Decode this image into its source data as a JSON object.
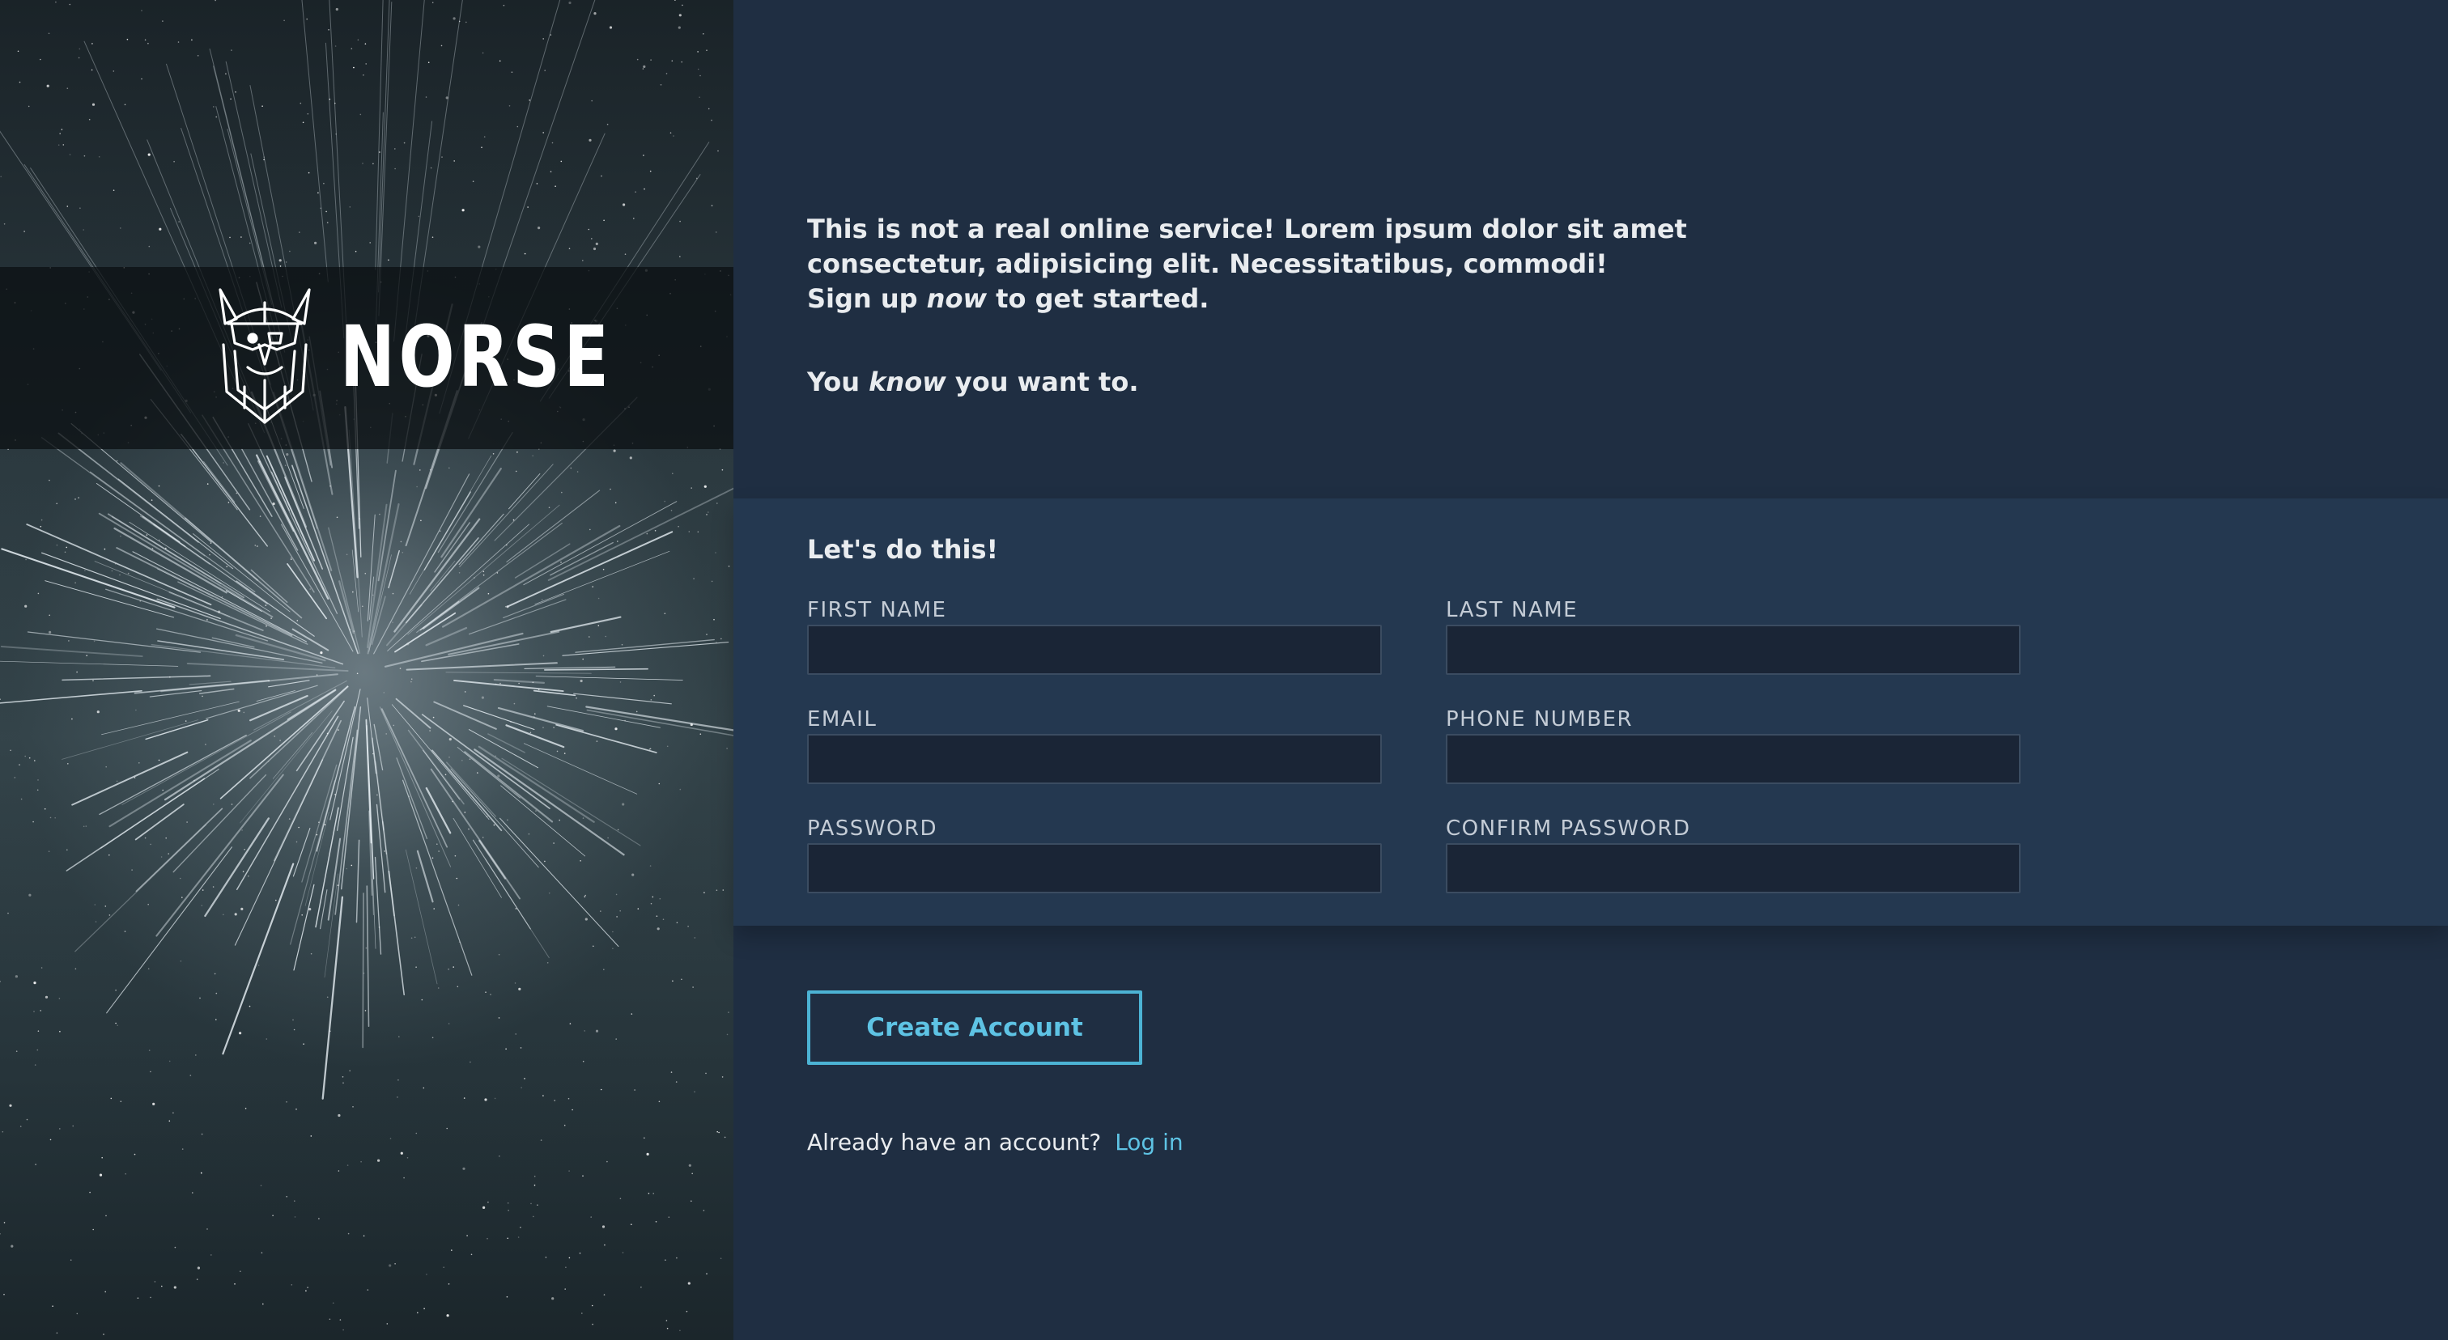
{
  "brand": {
    "name": "NORSE",
    "logo_icon": "viking-helmet-icon"
  },
  "intro": {
    "line1_part1": "This is not a real online service! Lorem ipsum dolor sit amet consectetur, adipisicing elit. Necessitatibus, commodi!",
    "line1_part2_before": "Sign up",
    "line1_part2_em": "now",
    "line1_part2_after": "to get started.",
    "line2_before": "You",
    "line2_em": "know",
    "line2_after": "you want to."
  },
  "form": {
    "heading": "Let's do this!",
    "fields": {
      "first_name": {
        "label": "FIRST NAME",
        "value": ""
      },
      "last_name": {
        "label": "LAST NAME",
        "value": ""
      },
      "email": {
        "label": "EMAIL",
        "value": ""
      },
      "phone": {
        "label": "PHONE NUMBER",
        "value": ""
      },
      "password": {
        "label": "PASSWORD",
        "value": ""
      },
      "confirm_password": {
        "label": "CONFIRM PASSWORD",
        "value": ""
      }
    },
    "submit_label": "Create Account"
  },
  "login": {
    "prompt": "Already have an account?",
    "link_label": "Log in"
  },
  "colors": {
    "background": "#1f2e42",
    "form_band": "#243850",
    "input_bg": "#1a2536",
    "accent": "#4cb3d4",
    "text": "#e9ecef"
  }
}
